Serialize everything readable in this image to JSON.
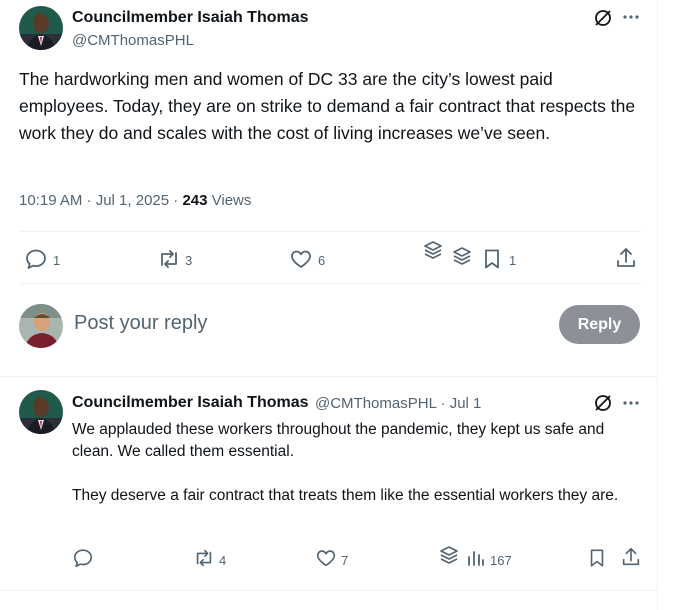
{
  "post": {
    "author_name": "Councilmember Isaiah Thomas",
    "author_handle": "@CMThomasPHL",
    "text": "The hardworking men and women of DC 33 are the city’s lowest paid employees. Today, they are on strike to demand a fair contract that respects the work they do and scales with the cost of living increases we’ve seen.",
    "time": "10:19 AM · Jul 1, 2025 · ",
    "views_count": "243",
    "views_label": " Views",
    "stats": {
      "replies": "1",
      "reposts": "3",
      "likes": "6",
      "bookmarks": "1"
    }
  },
  "composer": {
    "placeholder": "Post your reply",
    "reply_button": "Reply"
  },
  "reply": {
    "author_name": "Councilmember Isaiah Thomas",
    "author_handle_date": "@CMThomasPHL · Jul 1",
    "paragraph1": "We applauded these workers throughout the pandemic, they kept us safe and clean. We called them essential.",
    "paragraph2": "They deserve a fair contract that treats them like the essential workers they are.",
    "stats": {
      "replies": "",
      "reposts": "4",
      "likes": "7",
      "views": "167"
    }
  },
  "colors": {
    "text": "#0f1419",
    "secondary": "#536471",
    "divider": "#eff3f4",
    "reply_button_disabled": "#8b9196"
  }
}
